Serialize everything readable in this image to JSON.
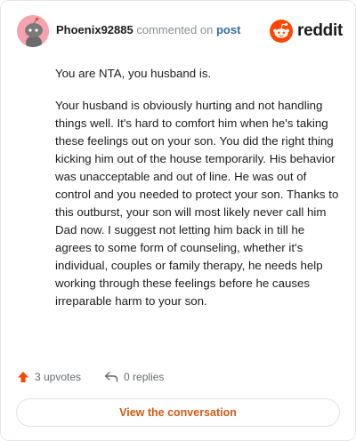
{
  "comment": {
    "username": "Phoenix92885",
    "action_text": "commented on",
    "post_link": "post",
    "paragraphs": [
      "You are NTA, you husband is.",
      "Your husband is obviously hurting and not handling things well. It's hard to comfort him when he's taking these feelings out on your son. You did the right thing kicking him out of the house temporarily. His behavior was unacceptable and out of line. He was out of control and you needed to protect your son. Thanks to this outburst, your son will most likely never call him Dad now. I suggest not letting him back in till he agrees to some form of counseling, whether it's individual, couples or family therapy, he needs help working through these feelings before he causes irreparable harm to your son."
    ],
    "upvotes": "3 upvotes",
    "replies": "0 replies"
  },
  "brand": {
    "name": "reddit"
  },
  "view_button": {
    "label": "View the conversation"
  },
  "icons": {
    "avatar": "snoo-avatar",
    "brand": "reddit-logo-icon",
    "upvote": "upvote-arrow-icon",
    "reply": "reply-arrow-icon"
  },
  "colors": {
    "accent": "#ff4500",
    "username": "#1c1c1c",
    "link": "#2d6ea8",
    "button_text": "#d05a14",
    "avatar_bg": "#f6a3b0"
  }
}
